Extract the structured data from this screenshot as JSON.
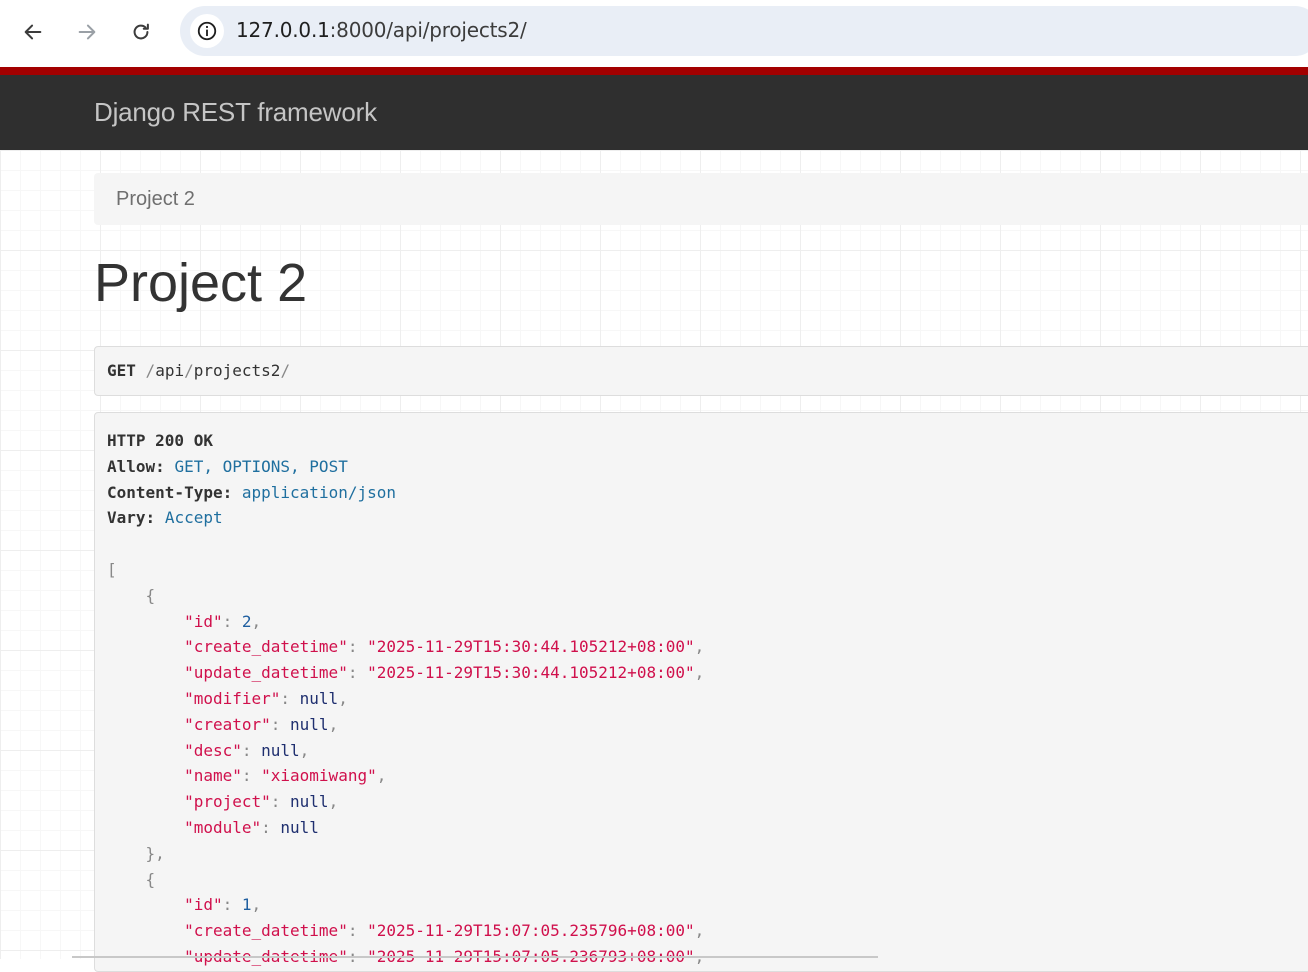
{
  "browser": {
    "url_host": "127.0.0.1",
    "url_rest": ":8000/api/projects2/"
  },
  "navbar": {
    "brand": "Django REST framework"
  },
  "breadcrumb": {
    "item": "Project 2"
  },
  "page": {
    "title": "Project 2"
  },
  "request": {
    "method": "GET",
    "path_parts": [
      "api",
      "projects2"
    ]
  },
  "response": {
    "status": "HTTP 200 OK",
    "headers": [
      {
        "key": "Allow",
        "value": "GET, OPTIONS, POST"
      },
      {
        "key": "Content-Type",
        "value": "application/json"
      },
      {
        "key": "Vary",
        "value": "Accept"
      }
    ],
    "items": [
      {
        "id": 2,
        "create_datetime": "2025-11-29T15:30:44.105212+08:00",
        "update_datetime": "2025-11-29T15:30:44.105212+08:00",
        "modifier": null,
        "creator": null,
        "desc": null,
        "name": "xiaomiwang",
        "project": null,
        "module": null
      },
      {
        "id": 1,
        "create_datetime": "2025-11-29T15:07:05.235796+08:00",
        "update_datetime": "2025-11-29T15:07:05.236793+08:00"
      }
    ]
  },
  "colors": {
    "navbar_bg": "#2f2f2f",
    "accent_strip": "#a30000",
    "json_key": "#d0104c",
    "json_number": "#1f5fa0",
    "header_value": "#1f6f9f"
  }
}
